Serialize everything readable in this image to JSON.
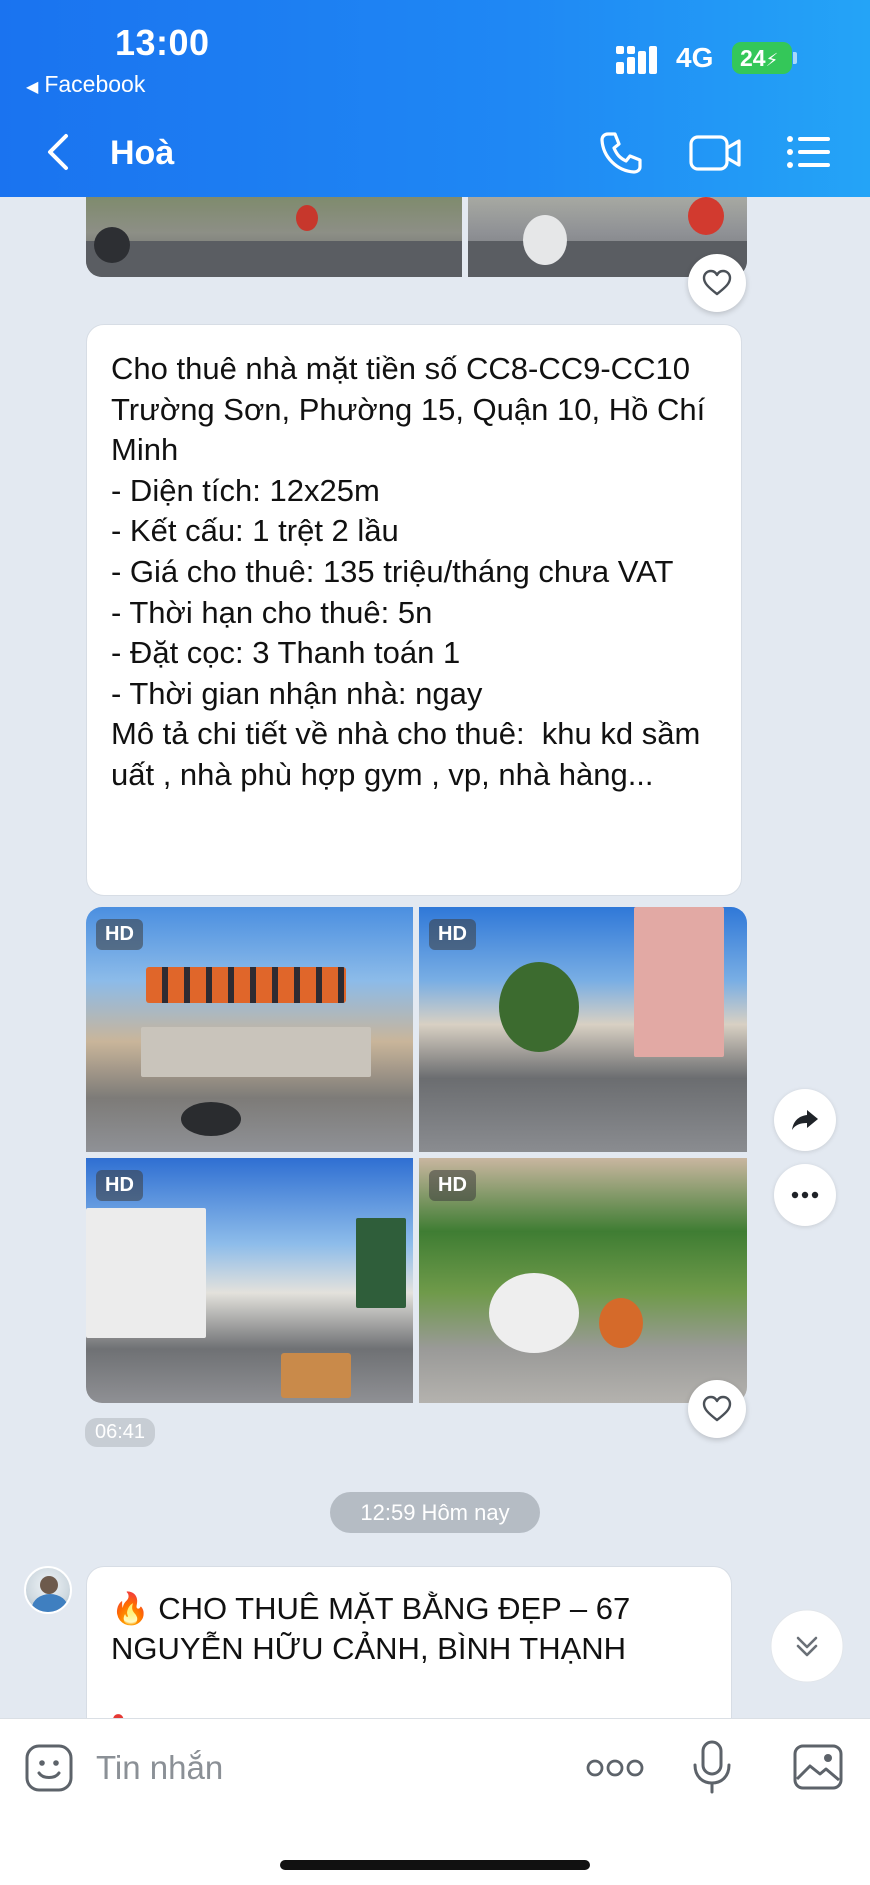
{
  "status_bar": {
    "time": "13:00",
    "back_app": "Facebook",
    "network": "4G",
    "battery": "24"
  },
  "nav": {
    "title": "Hoà",
    "icons": [
      "back-arrow-icon",
      "phone-icon",
      "video-call-icon",
      "list-menu-icon"
    ]
  },
  "messages": {
    "text1": "Cho thuê nhà mặt tiền số CC8-CC9-CC10 Trường Sơn, Phường 15, Quận 10, Hồ Chí Minh\n- Diện tích: 12x25m\n- Kết cấu: 1 trệt 2 lầu\n- Giá cho thuê: 135 triệu/tháng chưa VAT\n- Thời hạn cho thuê: 5n\n- Đặt cọc: 3 Thanh toán 1\n- Thời gian nhận nhà: ngay\nMô tả chi tiết về nhà cho thuê:  khu kd sầm uất , nhà phù hợp gym , vp, nhà hàng...",
    "photo_badges": [
      "HD",
      "HD",
      "HD",
      "HD"
    ],
    "time1": "06:41",
    "date_separator": "12:59 Hôm nay",
    "text2": "🔥 CHO THUÊ MẶT BẰNG ĐẸP – 67 NGUYỄN HỮU CẢNH, BÌNH THẠNH"
  },
  "input": {
    "placeholder": "Tin nhắn"
  },
  "colors": {
    "header_start": "#1a73f0",
    "header_end": "#24a4f7",
    "chat_bg": "#e3e9f1",
    "battery": "#34c759"
  }
}
